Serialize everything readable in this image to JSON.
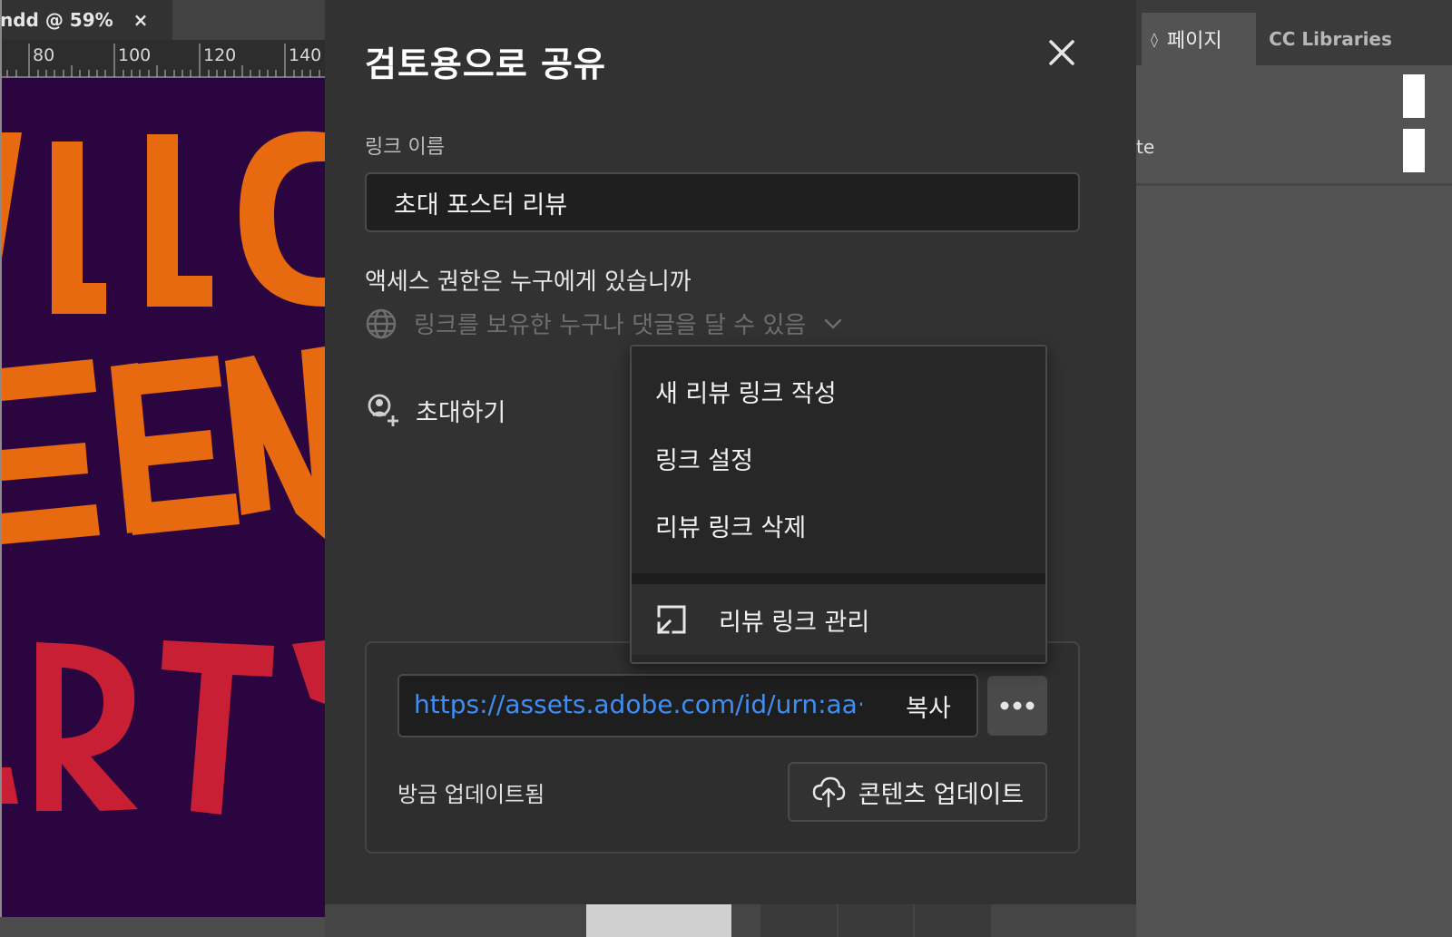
{
  "document": {
    "tab_label": "ndd @ 59%",
    "close_glyph": "×",
    "ruler_ticks": [
      "80",
      "100",
      "120",
      "140"
    ]
  },
  "right_panel": {
    "tabs": [
      {
        "label": "페이지",
        "icon": "updown-arrows-icon"
      },
      {
        "label": "CC Libraries"
      }
    ],
    "partial_text": "te",
    "arrows_glyph": "◊"
  },
  "dialog": {
    "title": "검토용으로 공유",
    "close_icon": "close-icon",
    "link_name": {
      "label": "링크 이름",
      "value": "초대 포스터 리뷰"
    },
    "access": {
      "label": "액세스 권한은 누구에게 있습니까",
      "value": "링크를 보유한 누구나 댓글을 달 수 있음",
      "icon": "globe-icon"
    },
    "invite": {
      "label": "초대하기",
      "icon": "add-user-icon"
    },
    "link": {
      "url": "https://assets.adobe.com/id/urn:aa···",
      "copy_label": "복사",
      "more_icon": "more-dots-icon"
    },
    "status": "방금 업데이트됨",
    "update_button": {
      "label": "콘텐츠 업데이트",
      "icon": "cloud-upload-icon"
    }
  },
  "menu": {
    "items": [
      "새 리뷰 링크 작성",
      "링크 설정",
      "리뷰 링크 삭제"
    ],
    "manage_label": "리뷰 링크 관리",
    "manage_icon": "open-external-icon"
  },
  "colors": {
    "dialog_bg": "#323232",
    "link_blue": "#3f8ef5",
    "canvas_bg": "#2b0540",
    "poster_orange": "#e86a10",
    "poster_red": "#c81f35"
  }
}
